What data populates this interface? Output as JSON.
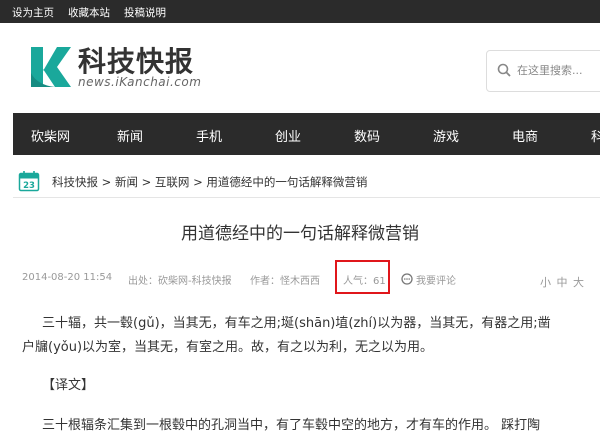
{
  "topbar": {
    "set_home": "设为主页",
    "bookmark": "收藏本站",
    "contribute": "投稿说明"
  },
  "logo": {
    "title": "科技快报",
    "url": "news.iKanchai.com"
  },
  "search": {
    "placeholder": "在这里搜索..."
  },
  "nav": {
    "items": [
      "砍柴网",
      "新闻",
      "手机",
      "创业",
      "数码",
      "游戏",
      "电商",
      "科"
    ]
  },
  "breadcrumb": {
    "date_badge": "23",
    "items": [
      "科技快报",
      "新闻",
      "互联网",
      "用道德经中的一句话解释微营销"
    ],
    "separator": ">"
  },
  "article": {
    "title": "用道德经中的一句话解释微营销",
    "meta": {
      "datetime": "2014-08-20 11:54",
      "source": "出处：砍柴网-科技快报",
      "author": "作者：怪木西西",
      "popularity": "人气：61",
      "comment": "我要评论"
    },
    "font_size": [
      "小",
      "中",
      "大"
    ],
    "paragraphs": [
      "三十辐，共一毂(gǔ)，当其无，有车之用;埏(shān)埴(zhí)以为器，当其无，有器之用;凿",
      "户牖(yǒu)以为室，当其无，有室之用。故，有之以为利，无之以为用。",
      "【译文】",
      "三十根辐条汇集到一根毂中的孔洞当中，有了车毂中空的地方，才有车的作用。 踩打陶"
    ]
  },
  "colors": {
    "dark_bar": "#2b2b2b",
    "logo_green": "#1aa89b",
    "highlight_red": "#e0161b"
  }
}
